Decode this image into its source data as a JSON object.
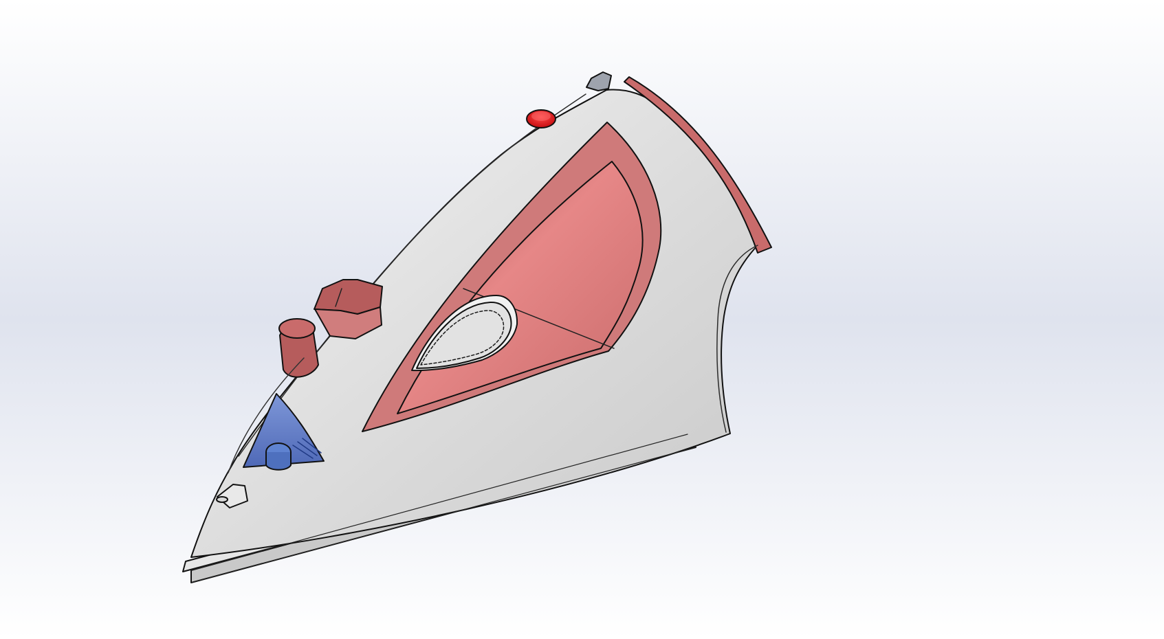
{
  "viewport": {
    "background_top": "#ffffff",
    "background_mid": "#dfe3ee",
    "background_bottom": "#ffffff"
  },
  "model": {
    "colors": {
      "body": "#d8d8d8",
      "body_light": "#f1f1f1",
      "accent": "#c96b6b",
      "accent_light": "#e68787",
      "accent_dark": "#a24f4f",
      "red_button": "#d10f12",
      "window": "#5d7ac4",
      "window_light": "#7e97d8",
      "outline": "#111111",
      "cap_gray": "#9ea3ad"
    },
    "icons": {
      "model_icon": "steam-iron-icon",
      "dial_icon": "temperature-dial-icon",
      "light_icon": "indicator-light-icon",
      "water_icon": "water-window-icon"
    }
  }
}
